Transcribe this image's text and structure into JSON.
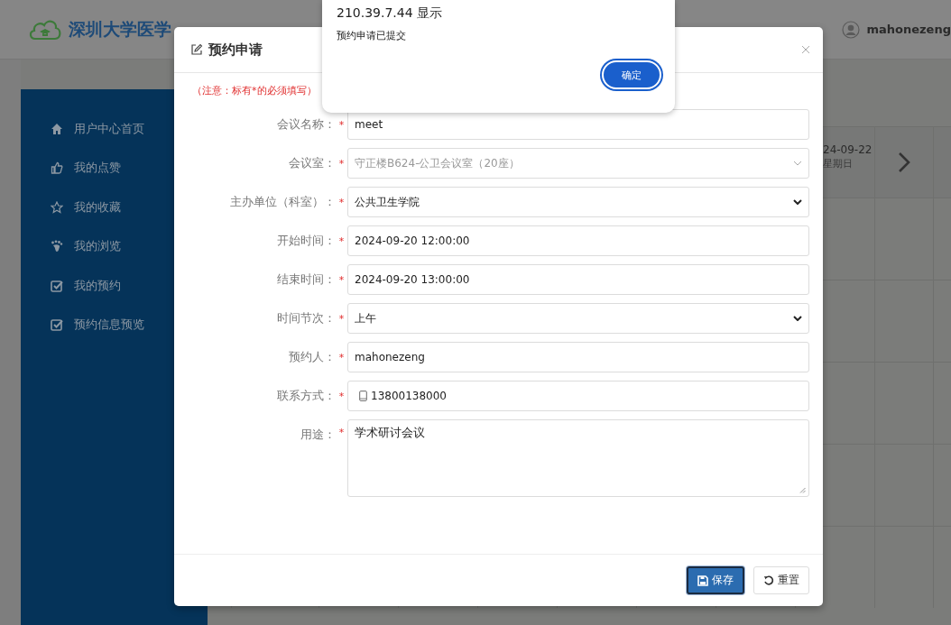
{
  "header": {
    "logo_text": "深圳大学医学",
    "user": "mahonezeng"
  },
  "sidebar": {
    "items": [
      {
        "label": "用户中心首页"
      },
      {
        "label": "我的点赞"
      },
      {
        "label": "我的收藏"
      },
      {
        "label": "我的浏览"
      },
      {
        "label": "我的预约"
      },
      {
        "label": "预约信息预览"
      }
    ]
  },
  "calendar": {
    "date": "24-09-22",
    "weekday": "星期日"
  },
  "dialog": {
    "title": "预约申请",
    "notice": "（注意：标有*的必须填写）",
    "fields": [
      {
        "label": "会议名称：",
        "required_mark": "*",
        "kind": "input",
        "value": "meet",
        "disabled": false
      },
      {
        "label": "会议室：",
        "required_mark": "*",
        "kind": "select",
        "value": "守正楼B624-公卫会议室（20座）",
        "disabled": true
      },
      {
        "label": "主办单位（科室）：",
        "required_mark": "*",
        "kind": "select",
        "value": "公共卫生学院",
        "disabled": false
      },
      {
        "label": "开始时间：",
        "required_mark": "*",
        "kind": "input",
        "value": "2024-09-20 12:00:00",
        "disabled": false
      },
      {
        "label": "结束时间：",
        "required_mark": "*",
        "kind": "input",
        "value": "2024-09-20 13:00:00",
        "disabled": false
      },
      {
        "label": "时间节次：",
        "required_mark": "*",
        "kind": "select",
        "value": "上午",
        "disabled": false
      },
      {
        "label": "预约人：",
        "required_mark": "*",
        "kind": "input",
        "value": "mahonezeng",
        "disabled": false
      },
      {
        "label": "联系方式：",
        "required_mark": "*",
        "kind": "phone",
        "value": "13800138000",
        "disabled": false
      },
      {
        "label": "用途：",
        "required_mark": "*",
        "kind": "textarea",
        "value": "学术研讨会议",
        "disabled": false
      }
    ],
    "buttons": [
      {
        "label": "保存",
        "kind": "primary",
        "focused": true
      },
      {
        "label": "重置",
        "kind": "default",
        "focused": false
      }
    ]
  },
  "alert": {
    "title": "210.39.7.44 显示",
    "message": "预约申请已提交",
    "button": "确定"
  }
}
